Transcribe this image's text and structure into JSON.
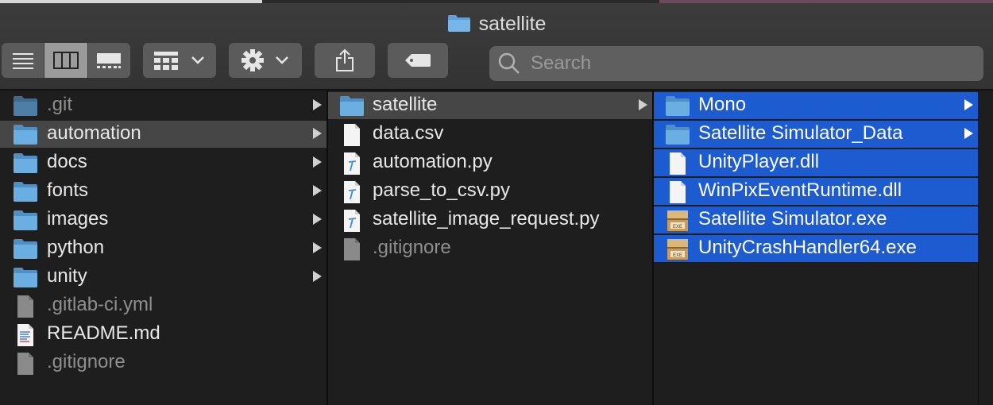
{
  "window": {
    "title": "satellite"
  },
  "toolbar": {
    "view_modes": [
      "list-view-icon",
      "column-view-icon",
      "gallery-view-icon"
    ],
    "active_view": "column",
    "search_placeholder": "Search"
  },
  "columns": [
    {
      "items": [
        {
          "label": ".git",
          "kind": "folder",
          "dim": true,
          "arrow": true
        },
        {
          "label": "automation",
          "kind": "folder",
          "arrow": true,
          "selected": "grey"
        },
        {
          "label": "docs",
          "kind": "folder",
          "arrow": true
        },
        {
          "label": "fonts",
          "kind": "folder",
          "arrow": true
        },
        {
          "label": "images",
          "kind": "folder",
          "arrow": true
        },
        {
          "label": "python",
          "kind": "folder",
          "arrow": true
        },
        {
          "label": "unity",
          "kind": "folder",
          "arrow": true
        },
        {
          "label": ".gitlab-ci.yml",
          "kind": "doc-grey",
          "dim": true
        },
        {
          "label": "README.md",
          "kind": "doc-text"
        },
        {
          "label": ".gitignore",
          "kind": "doc-grey",
          "dim": true
        }
      ]
    },
    {
      "items": [
        {
          "label": "satellite",
          "kind": "folder",
          "arrow": true,
          "selected": "grey"
        },
        {
          "label": "data.csv",
          "kind": "doc-white"
        },
        {
          "label": "automation.py",
          "kind": "doc-python"
        },
        {
          "label": "parse_to_csv.py",
          "kind": "doc-python"
        },
        {
          "label": "satellite_image_request.py",
          "kind": "doc-python"
        },
        {
          "label": ".gitignore",
          "kind": "doc-grey",
          "dim": true
        }
      ]
    },
    {
      "items": [
        {
          "label": "Mono",
          "kind": "folder",
          "arrow": true,
          "selected": "blue"
        },
        {
          "label": "Satellite Simulator_Data",
          "kind": "folder",
          "arrow": true,
          "selected": "blue"
        },
        {
          "label": "UnityPlayer.dll",
          "kind": "doc-white",
          "selected": "blue"
        },
        {
          "label": "WinPixEventRuntime.dll",
          "kind": "doc-white",
          "selected": "blue"
        },
        {
          "label": "Satellite Simulator.exe",
          "kind": "exe",
          "selected": "blue"
        },
        {
          "label": "UnityCrashHandler64.exe",
          "kind": "exe",
          "selected": "blue"
        }
      ]
    }
  ]
}
